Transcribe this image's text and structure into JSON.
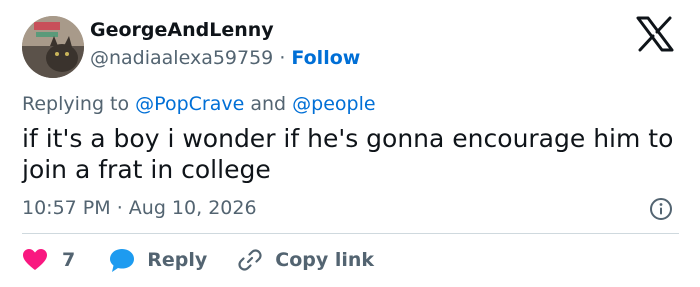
{
  "user": {
    "display_name": "GeorgeAndLenny",
    "handle": "@nadiaalexa59759",
    "separator": "·",
    "follow_label": "Follow"
  },
  "reply_context": {
    "prefix": "Replying to",
    "mention_1": "@PopCrave",
    "conjunction": "and",
    "mention_2": "@people"
  },
  "tweet": {
    "text": "if it's a boy i wonder if he's gonna encourage him to join a frat in college"
  },
  "meta": {
    "time": "10:57 PM",
    "separator": "·",
    "date": "Aug 10, 2026"
  },
  "actions": {
    "like_count": "7",
    "reply_label": "Reply",
    "copy_link_label": "Copy link"
  },
  "colors": {
    "accent": "#006fd6",
    "like": "#f91880",
    "reply": "#1d9bf0",
    "muted": "#536471",
    "text": "#0f1419",
    "divider": "#cfd9de"
  },
  "icons": [
    "x-logo-icon",
    "info-icon",
    "heart-icon",
    "reply-bubble-icon",
    "link-icon"
  ]
}
